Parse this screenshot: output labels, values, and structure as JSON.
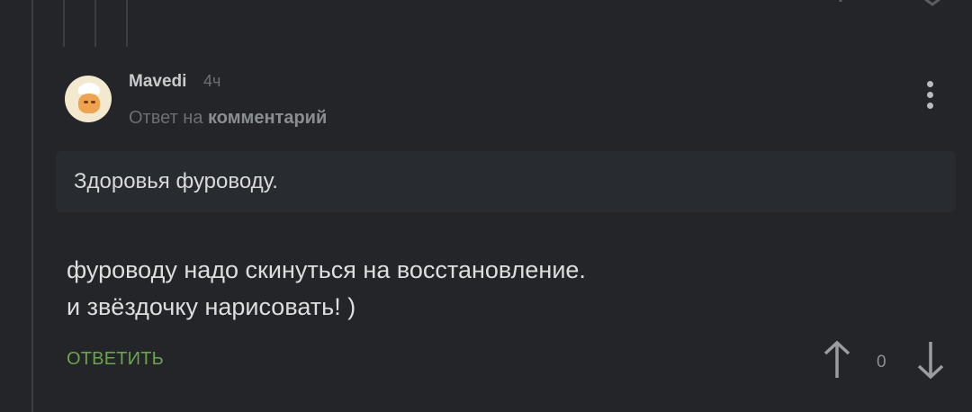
{
  "comment": {
    "username": "Mavedi",
    "time": "4ч",
    "reply_to_prefix": "Ответ на",
    "reply_to_link": "комментарий",
    "quote": "Здоровья фуроводу.",
    "body_line1": "фуроводу надо скинуться на восстановление.",
    "body_line2": "и звёздочку нарисовать! )",
    "reply_label": "ОТВЕТИТЬ",
    "rating": "0"
  },
  "icons": {
    "more": "more-vertical-icon",
    "upvote": "arrow-up-icon",
    "downvote": "arrow-down-icon"
  },
  "colors": {
    "background": "#232528",
    "accent_green": "#6aa54c",
    "text": "#dcdee0",
    "muted": "#6c7075"
  }
}
